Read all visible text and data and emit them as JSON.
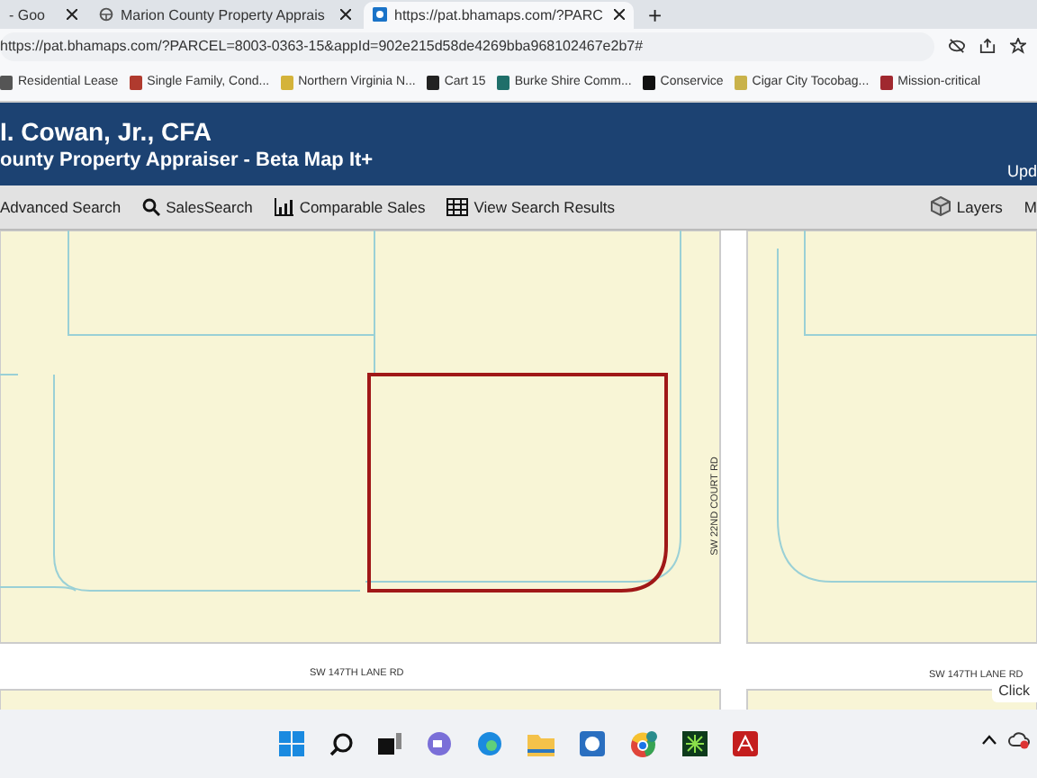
{
  "browser": {
    "tabs": [
      {
        "title": "- Goo",
        "kind": "none",
        "selected": false
      },
      {
        "title": "Marion County Property Apprais",
        "kind": "wheel",
        "selected": false
      },
      {
        "title": "https://pat.bhamaps.com/?PARC",
        "kind": "site",
        "selected": true
      }
    ],
    "new_tab": "+",
    "address": "https://pat.bhamaps.com/?PARCEL=8003-0363-15&appId=902e215d58de4269bba968102467e2b7#",
    "bookmarks": [
      {
        "label": "Residential Lease",
        "color": "#555555"
      },
      {
        "label": "Single Family, Cond...",
        "color": "#b03a2e"
      },
      {
        "label": "Northern Virginia N...",
        "color": "#d4b33a"
      },
      {
        "label": "Cart 15",
        "color": "#222222"
      },
      {
        "label": "Burke Shire Comm...",
        "color": "#1f6f6a"
      },
      {
        "label": "Conservice",
        "color": "#111111"
      },
      {
        "label": "Cigar City Tocobag...",
        "color": "#c9b24a"
      },
      {
        "label": "Mission-critical",
        "color": "#a0282f"
      }
    ]
  },
  "header": {
    "title": "I. Cowan, Jr., CFA",
    "subtitle": "ounty Property Appraiser - Beta Map It+",
    "right": "Upd"
  },
  "toolbar": {
    "items": [
      {
        "label": "Advanced Search",
        "kind": "plain"
      },
      {
        "label": "SalesSearch",
        "kind": "search"
      },
      {
        "label": "Comparable Sales",
        "kind": "chart"
      },
      {
        "label": "View Search Results",
        "kind": "grid"
      }
    ],
    "layers": "Layers",
    "cut": "M"
  },
  "map": {
    "roads": [
      {
        "label": "SW 22ND COURT RD",
        "kind": "vertical"
      },
      {
        "label": "SW 147TH LANE RD",
        "kind": "horizontal"
      },
      {
        "label": "SW 147TH LANE RD",
        "kind": "horizontal"
      }
    ],
    "tooltip": "Click"
  }
}
